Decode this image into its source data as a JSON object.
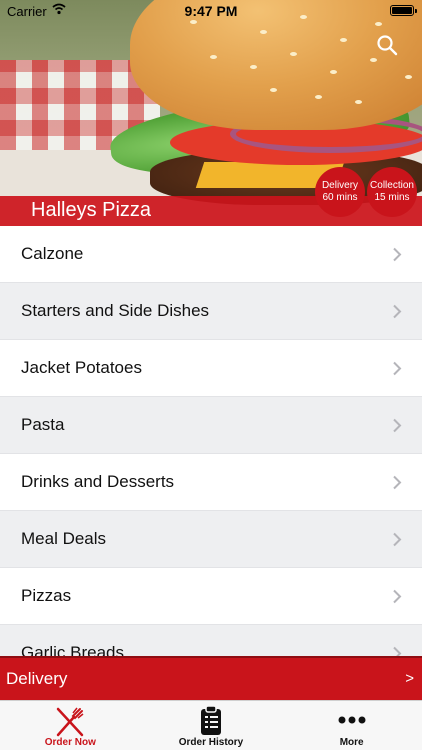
{
  "status_bar": {
    "carrier": "Carrier",
    "time": "9:47 PM"
  },
  "header": {
    "restaurant_name": "Halleys Pizza",
    "delivery_badge": {
      "line1": "Delivery",
      "line2": "60 mins"
    },
    "collection_badge": {
      "line1": "Collection",
      "line2": "15 mins"
    }
  },
  "categories": [
    {
      "label": "Calzone"
    },
    {
      "label": "Starters and Side Dishes"
    },
    {
      "label": "Jacket Potatoes"
    },
    {
      "label": "Pasta"
    },
    {
      "label": "Drinks and Desserts"
    },
    {
      "label": "Meal Deals"
    },
    {
      "label": "Pizzas"
    },
    {
      "label": "Garlic Breads"
    }
  ],
  "delivery_bar": {
    "label": "Delivery",
    "arrow": ">"
  },
  "tabbar": {
    "tabs": [
      {
        "label": "Order Now",
        "icon": "fork-knife-icon",
        "active": true
      },
      {
        "label": "Order History",
        "icon": "clipboard-icon",
        "active": false
      },
      {
        "label": "More",
        "icon": "more-dots-icon",
        "active": false
      }
    ]
  },
  "colors": {
    "accent": "#c9141b",
    "row_alt": "#eeeff1"
  }
}
